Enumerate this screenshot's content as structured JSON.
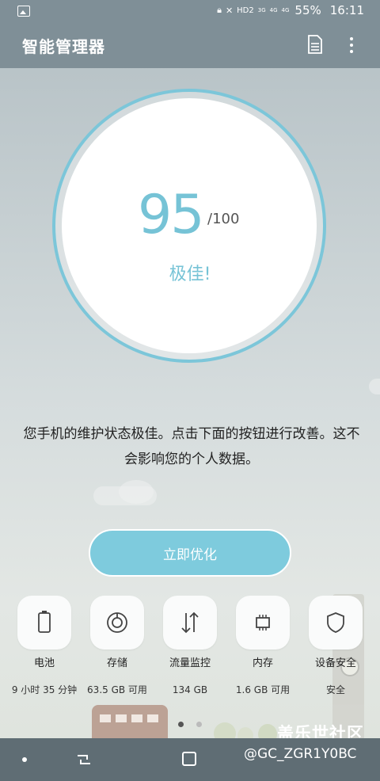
{
  "status_bar": {
    "network_labels": [
      "HD2",
      "3G",
      "4G",
      "4G"
    ],
    "battery": "55%",
    "time": "16:11"
  },
  "app_bar": {
    "title": "智能管理器",
    "icons": [
      "document-icon",
      "more-vert-icon"
    ]
  },
  "score": {
    "value": "95",
    "max": "/100",
    "rating": "极佳!"
  },
  "description": "您手机的维护状态极佳。点击下面的按钮进行改善。这不会影响您的个人数据。",
  "optimize_button": "立即优化",
  "features": [
    {
      "icon": "battery-icon",
      "label": "电池",
      "value": "9 小时 35 分钟"
    },
    {
      "icon": "storage-icon",
      "label": "存储",
      "value": "63.5 GB 可用"
    },
    {
      "icon": "data-usage-icon",
      "label": "流量监控",
      "value": "134 GB"
    },
    {
      "icon": "memory-icon",
      "label": "内存",
      "value": "1.6 GB 可用"
    },
    {
      "icon": "security-icon",
      "label": "设备安全",
      "value": "安全"
    }
  ],
  "pager": {
    "pages": 2,
    "active": 0
  },
  "watermark": {
    "line1": "盖乐世社区",
    "line2": "@GC_ZGR1Y0BC"
  },
  "colors": {
    "accent": "#7ecbdd",
    "app_bar": "#7f8f97",
    "nav_bar": "#5f6d74"
  }
}
